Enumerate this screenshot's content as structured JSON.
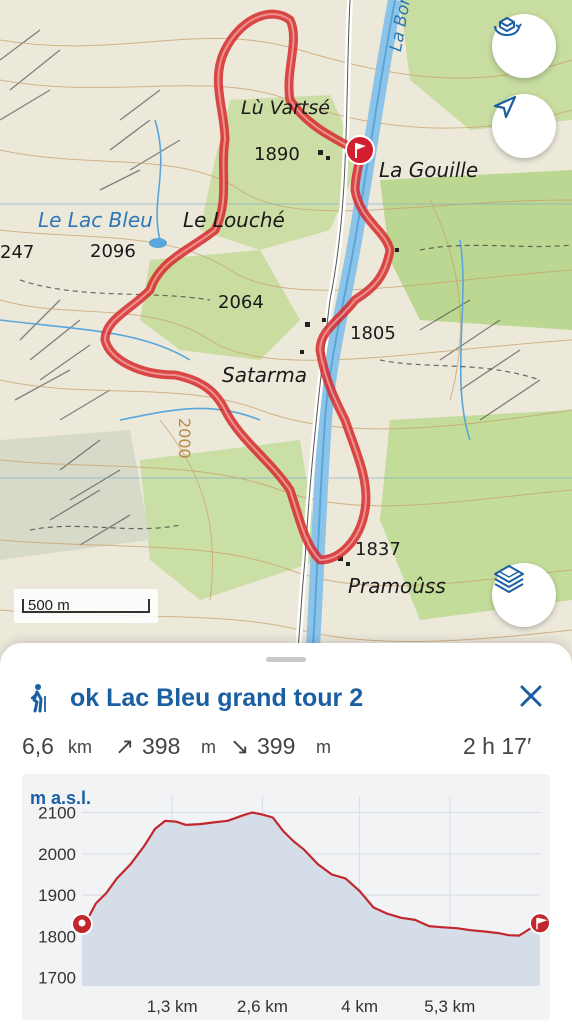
{
  "map": {
    "labels": {
      "lu_vartse": "Lù Vartsé",
      "la_gouille": "La Gouille",
      "le_lac_bleu": "Le Lac Bleu",
      "le_louche": "Le Louché",
      "satarma": "Satarma",
      "pramouss": "Pramoûss",
      "la_borgne": "La Borgn",
      "alt_1890": "1890",
      "alt_2096": "2096",
      "alt_2064": "2064",
      "alt_1805": "1805",
      "alt_1837": "1837",
      "alt_247": "247",
      "contour_2000": "2000"
    },
    "scale_label": "500 m",
    "buttons": {
      "rotate_icon": "rotate-3d-icon",
      "locate_icon": "navigation-arrow-icon",
      "layers_icon": "layers-icon"
    },
    "colors": {
      "route": "#d62a2a",
      "forest": "#b7d48e",
      "water": "#5aa6d9",
      "marker": "#d11f2f"
    }
  },
  "sheet": {
    "activity_icon": "hiking-icon",
    "title": "ok Lac Bleu grand tour 2",
    "close_icon": "close-icon",
    "stats": {
      "distance": "6,6",
      "distance_unit": "km",
      "ascent_arrow": "↗",
      "ascent": "398",
      "ascent_unit": "m",
      "descent_arrow": "↘",
      "descent": "399",
      "descent_unit": "m",
      "duration": "2 h 17′"
    }
  },
  "chart_data": {
    "type": "area",
    "ylabel": "m a.s.l.",
    "xlabel": "",
    "ylim": [
      1680,
      2140
    ],
    "xlim": [
      0,
      6.6
    ],
    "yticks": [
      "2100",
      "2000",
      "1900",
      "1800",
      "1700"
    ],
    "xticks": [
      "1,3 km",
      "2,6 km",
      "4 km",
      "5,3 km"
    ],
    "ytick_values": [
      2100,
      2000,
      1900,
      1800,
      1700
    ],
    "xtick_values": [
      1.3,
      2.6,
      4.0,
      5.3
    ],
    "series": [
      {
        "x": [
          0,
          0.1,
          0.2,
          0.35,
          0.5,
          0.7,
          0.9,
          1.05,
          1.2,
          1.35,
          1.5,
          1.7,
          1.9,
          2.1,
          2.3,
          2.45,
          2.6,
          2.75,
          2.9,
          3.05,
          3.2,
          3.4,
          3.6,
          3.8,
          4.0,
          4.2,
          4.4,
          4.6,
          4.8,
          5.0,
          5.2,
          5.4,
          5.6,
          5.8,
          6.0,
          6.15,
          6.3,
          6.45,
          6.6
        ],
        "y": [
          1830,
          1848,
          1880,
          1905,
          1940,
          1975,
          2020,
          2060,
          2080,
          2078,
          2070,
          2072,
          2076,
          2080,
          2092,
          2100,
          2095,
          2088,
          2055,
          2030,
          2010,
          1975,
          1950,
          1940,
          1910,
          1870,
          1855,
          1845,
          1840,
          1825,
          1822,
          1820,
          1815,
          1812,
          1808,
          1803,
          1802,
          1818,
          1832
        ]
      }
    ],
    "grid": true
  }
}
